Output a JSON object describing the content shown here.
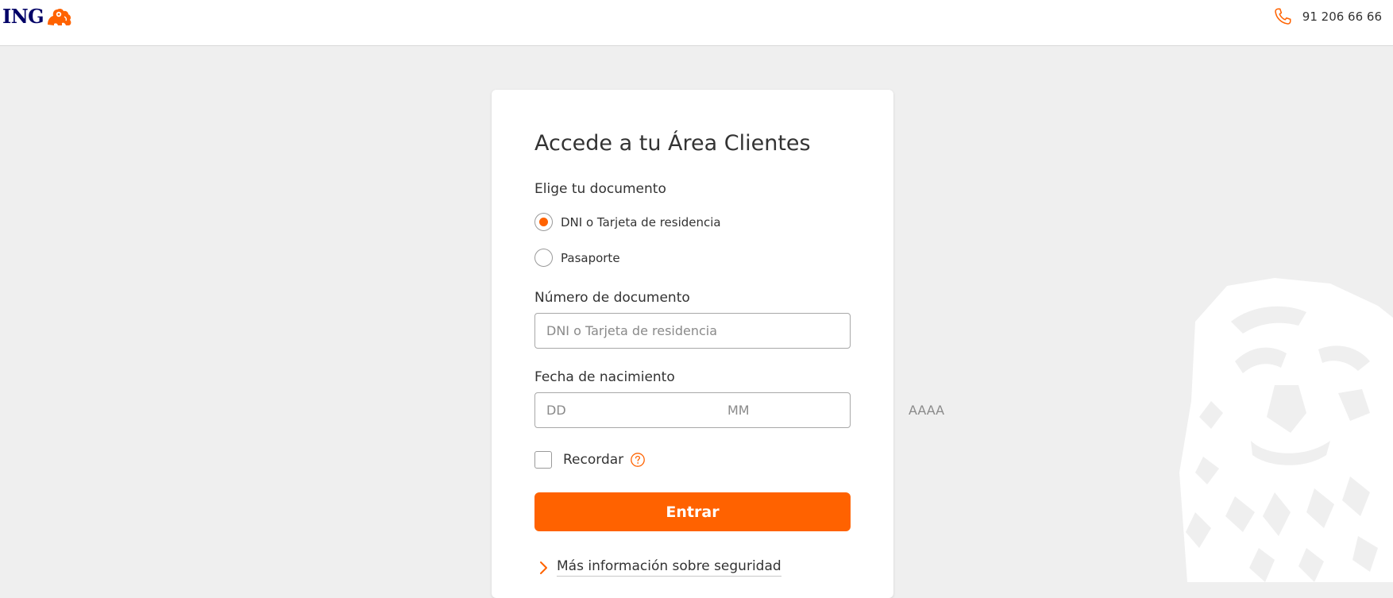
{
  "header": {
    "logo_text": "ING",
    "phone_icon": "phone-icon",
    "phone_number": "91 206 66 66"
  },
  "login": {
    "title": "Accede a tu Área Clientes",
    "document_label": "Elige tu documento",
    "document_options": [
      {
        "label": "DNI o Tarjeta de residencia",
        "selected": true
      },
      {
        "label": "Pasaporte",
        "selected": false
      }
    ],
    "document_number_label": "Número de documento",
    "document_number_placeholder": "DNI o Tarjeta de residencia",
    "document_number_value": "",
    "birthdate_label": "Fecha de nacimiento",
    "birthdate": {
      "day_placeholder": "DD",
      "month_placeholder": "MM",
      "year_placeholder": "AAAA"
    },
    "remember_label": "Recordar",
    "remember_checked": false,
    "submit_label": "Entrar",
    "security_link": "Más información sobre seguridad"
  },
  "colors": {
    "brand_orange": "#ff6200",
    "brand_navy": "#000066",
    "background": "#efefef"
  }
}
